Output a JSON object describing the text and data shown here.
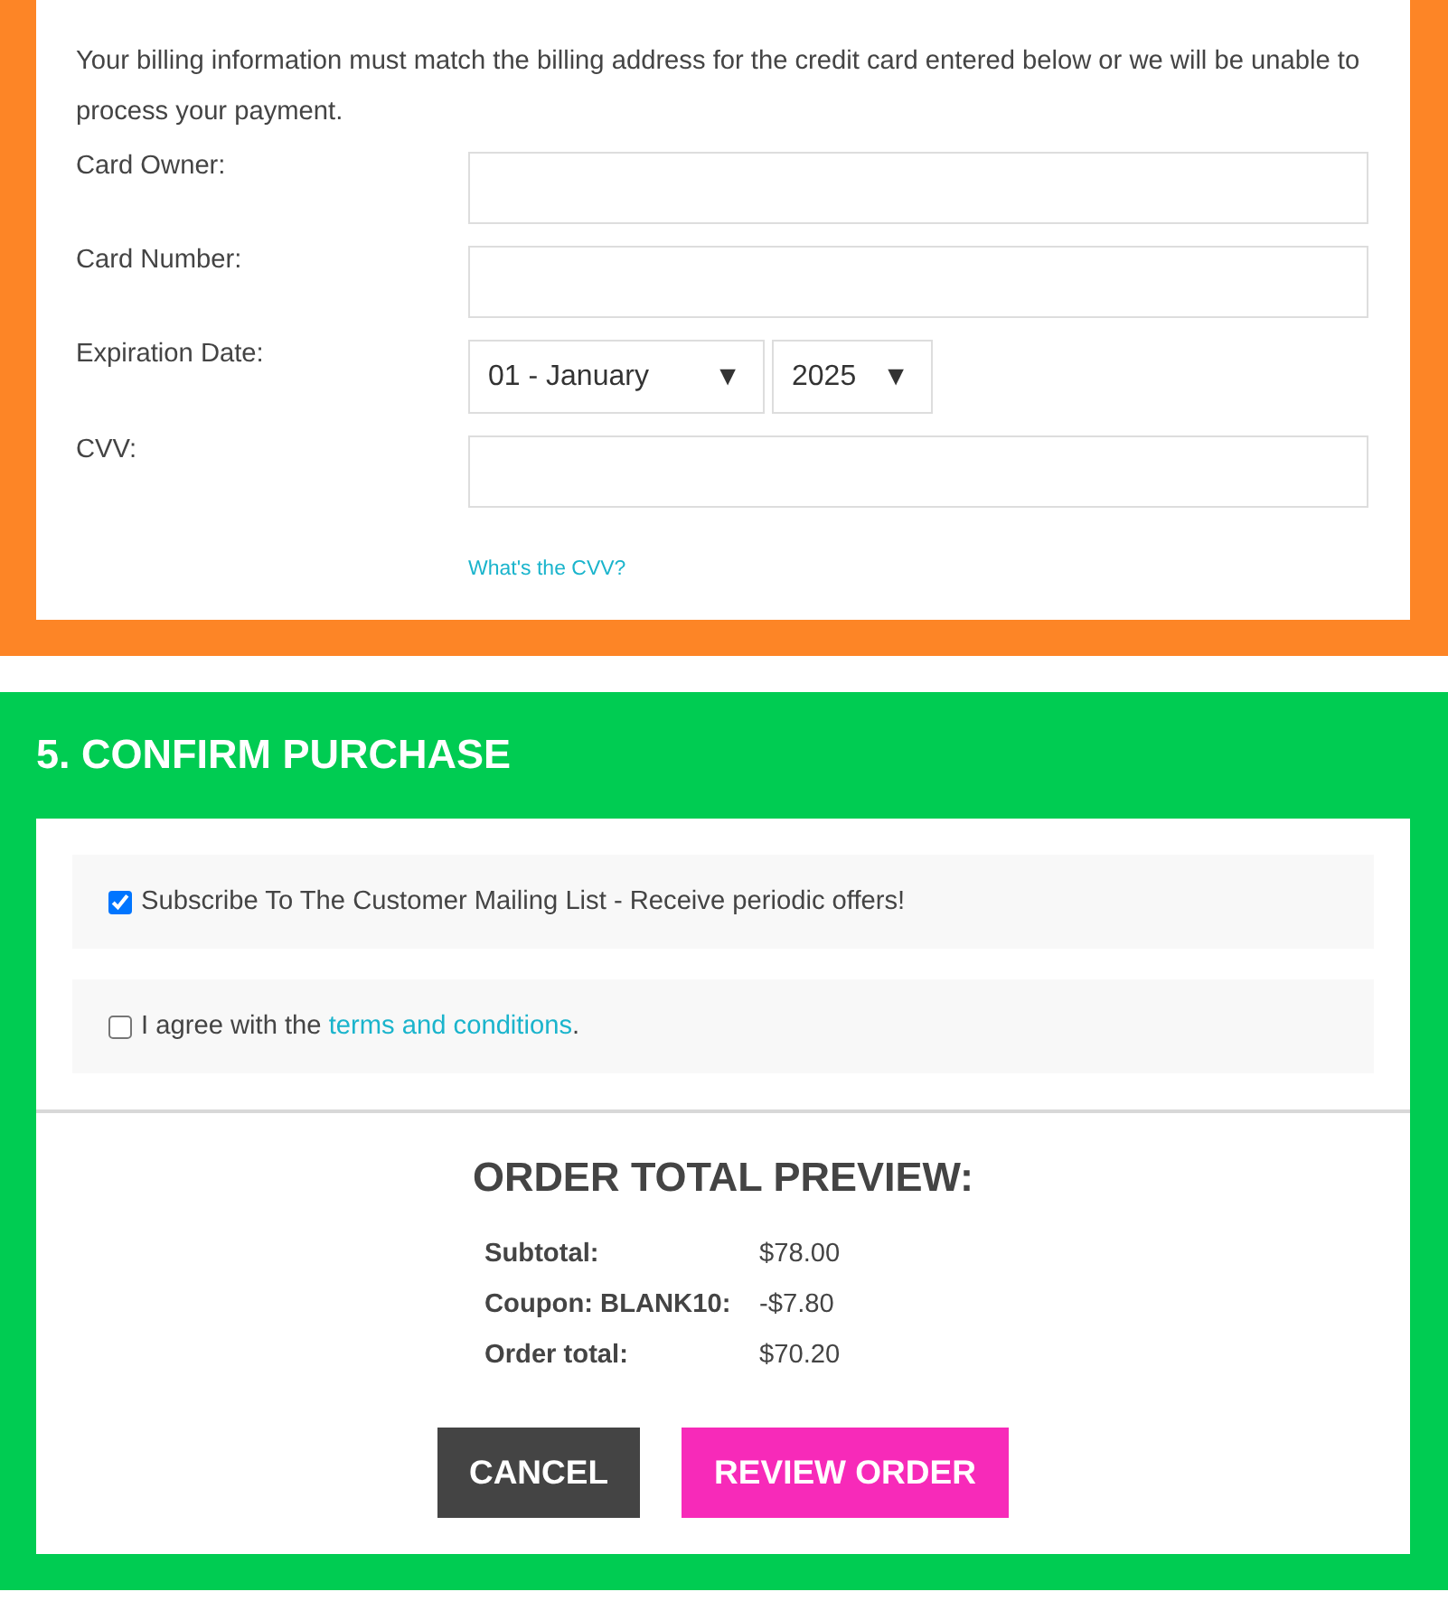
{
  "billing": {
    "notice": "Your billing information must match the billing address for the credit card entered below or we will be unable to process your payment.",
    "fields": [
      {
        "kind": "text",
        "label": "Card Owner:"
      },
      {
        "kind": "text",
        "label": "Card Number:"
      },
      {
        "kind": "selects",
        "label": "Expiration Date:",
        "selects": [
          {
            "value": "01 - January",
            "arrow": "▼"
          },
          {
            "value": "2025",
            "arrow": "▼"
          }
        ]
      },
      {
        "kind": "text",
        "label": "CVV:",
        "link": "What's the CVV?"
      }
    ]
  },
  "confirm": {
    "title": "5. CONFIRM PURCHASE",
    "options": [
      {
        "checked": true,
        "text": "Subscribe To The Customer Mailing List - Receive periodic offers!"
      },
      {
        "checked": false,
        "text": "I agree with the ",
        "link": "terms and conditions",
        "after": "."
      }
    ]
  },
  "preview": {
    "title": "ORDER TOTAL PREVIEW:",
    "rows": [
      {
        "label": "Subtotal:",
        "value": "$78.00"
      },
      {
        "label": "Coupon: BLANK10:",
        "value": "-$7.80"
      },
      {
        "label": "Order total:",
        "value": "$70.20"
      }
    ]
  },
  "buttons": [
    {
      "kind": "cancel",
      "label": "CANCEL"
    },
    {
      "kind": "primary",
      "label": "REVIEW ORDER"
    }
  ]
}
